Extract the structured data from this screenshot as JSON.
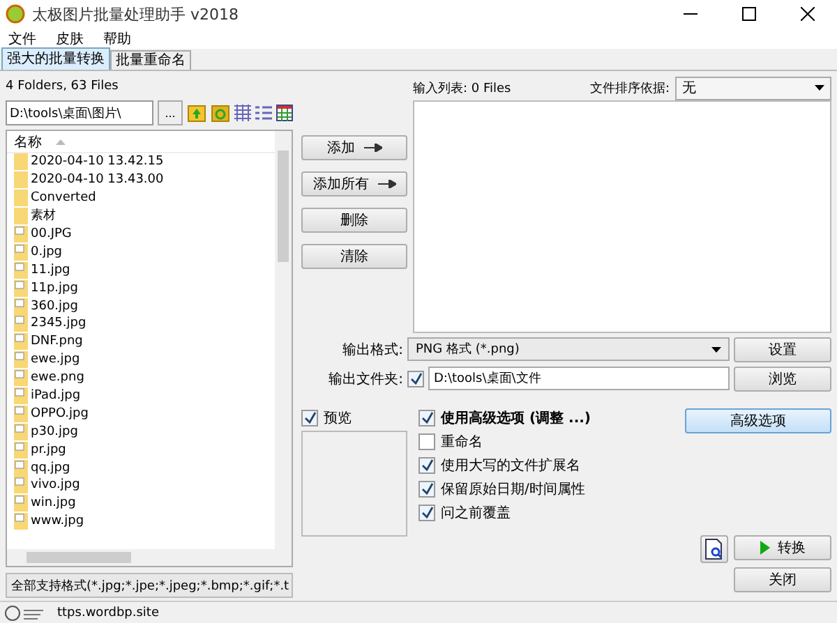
{
  "window": {
    "title": "太极图片批量处理助手  v2018"
  },
  "menu": [
    "文件",
    "皮肤",
    "帮助"
  ],
  "tabs": [
    {
      "label": "强大的批量转换",
      "selected": true
    },
    {
      "label": "批量重命名",
      "selected": false
    }
  ],
  "file_browser": {
    "summary": "4 Folders, 63 Files",
    "path": "D:\\tools\\桌面\\图片\\",
    "browse_button": "...",
    "column": "名称",
    "items": [
      {
        "name": "2020-04-10 13.42.15",
        "kind": "folder"
      },
      {
        "name": "2020-04-10 13.43.00",
        "kind": "folder"
      },
      {
        "name": "Converted",
        "kind": "folder"
      },
      {
        "name": "素材",
        "kind": "folder"
      },
      {
        "name": "00.JPG",
        "kind": "file"
      },
      {
        "name": "0.jpg",
        "kind": "file"
      },
      {
        "name": "11.jpg",
        "kind": "file"
      },
      {
        "name": "11p.jpg",
        "kind": "file"
      },
      {
        "name": "360.jpg",
        "kind": "file"
      },
      {
        "name": "2345.jpg",
        "kind": "file"
      },
      {
        "name": "DNF.png",
        "kind": "file"
      },
      {
        "name": "ewe.jpg",
        "kind": "file"
      },
      {
        "name": "ewe.png",
        "kind": "file"
      },
      {
        "name": "iPad.jpg",
        "kind": "file"
      },
      {
        "name": "OPPO.jpg",
        "kind": "file"
      },
      {
        "name": "p30.jpg",
        "kind": "file"
      },
      {
        "name": "pr.jpg",
        "kind": "file"
      },
      {
        "name": "qq.jpg",
        "kind": "file"
      },
      {
        "name": "vivo.jpg",
        "kind": "file"
      },
      {
        "name": "win.jpg",
        "kind": "file"
      },
      {
        "name": "www.jpg",
        "kind": "file"
      }
    ],
    "filter": "全部支持格式(*.jpg;*.jpe;*.jpeg;*.bmp;*.gif;*.t"
  },
  "list_buttons": [
    {
      "label": "添加",
      "arrow": true
    },
    {
      "label": "添加所有",
      "arrow": true
    },
    {
      "label": "删除",
      "arrow": false
    },
    {
      "label": "清除",
      "arrow": false
    }
  ],
  "input_list": {
    "label": "输入列表: 0 Files"
  },
  "sort": {
    "label": "文件排序依据:",
    "value": "无"
  },
  "output_format": {
    "label": "输出格式:",
    "value": "PNG 格式  (*.png)",
    "button": "设置"
  },
  "output_folder": {
    "label": "输出文件夹:",
    "checked": true,
    "value": "D:\\tools\\桌面\\文件",
    "button": "浏览"
  },
  "preview": {
    "label": "预览",
    "checked": true
  },
  "options": [
    {
      "label": "使用高级选项 (调整 ...)",
      "checked": true,
      "bold": true
    },
    {
      "label": "重命名",
      "checked": false,
      "bold": false
    },
    {
      "label": "使用大写的文件扩展名",
      "checked": true,
      "bold": false
    },
    {
      "label": "保留原始日期/时间属性",
      "checked": true,
      "bold": false
    },
    {
      "label": "问之前覆盖",
      "checked": true,
      "bold": false
    }
  ],
  "advanced_button": "高级选项",
  "convert_button": "转换",
  "close_button": "关闭",
  "status_bar": {
    "text": "ttps.wordbp.site"
  }
}
